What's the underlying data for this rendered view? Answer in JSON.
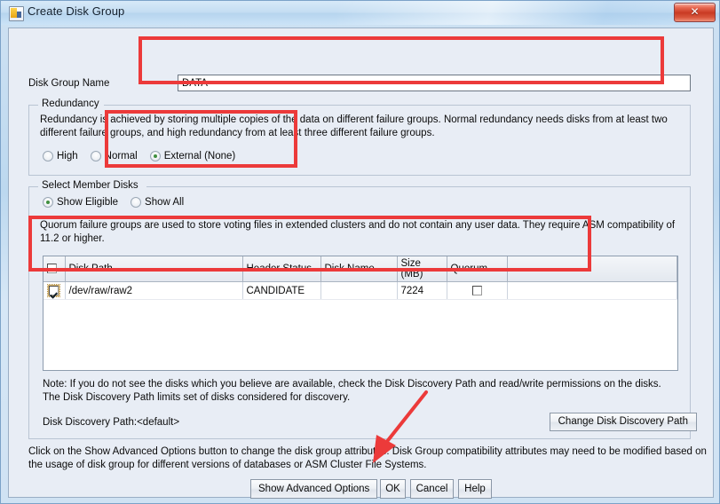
{
  "window": {
    "title": "Create Disk Group",
    "icon": "disk-group-icon",
    "close_label": "✕",
    "close_color": "#c93a23"
  },
  "form": {
    "disk_group_name_label": "Disk Group Name",
    "disk_group_name_value": "DATA"
  },
  "redundancy": {
    "legend": "Redundancy",
    "description": "Redundancy is achieved by storing multiple copies of the data on different failure groups. Normal redundancy needs disks from at least two different failure groups, and high redundancy from at least three different failure groups.",
    "options": [
      {
        "label": "High",
        "selected": false
      },
      {
        "label": "Normal",
        "selected": false
      },
      {
        "label": "External (None)",
        "selected": true
      }
    ]
  },
  "members": {
    "legend": "Select Member Disks",
    "filters": [
      {
        "label": "Show Eligible",
        "selected": true
      },
      {
        "label": "Show All",
        "selected": false
      }
    ],
    "quorum_note": "Quorum failure groups are used to store voting files in extended clusters and do not contain any user data. They require ASM compatibility of 11.2 or higher.",
    "table": {
      "header_checkbox_checked": false,
      "columns": [
        "",
        "Disk Path",
        "Header Status",
        "Disk Name",
        "Size (MB)",
        "Quorum"
      ],
      "rows": [
        {
          "selected": true,
          "disk_path": "/dev/raw/raw2",
          "header_status": "CANDIDATE",
          "disk_name": "",
          "size_mb": "7224",
          "quorum": false
        }
      ]
    },
    "note": "Note: If you do not see the disks which you believe are available, check the Disk Discovery Path and read/write permissions on the disks. The Disk Discovery Path limits set of disks considered for discovery.",
    "discovery_path_label": "Disk Discovery Path:<default>",
    "change_path_button": "Change Disk Discovery Path"
  },
  "footer": {
    "hint": "Click on the Show Advanced Options button to change the disk group attributes. Disk Group compatibility attributes may need to be modified based on the usage of disk group for different versions of databases or ASM Cluster File Systems.",
    "buttons": [
      {
        "label": "Show Advanced Options",
        "name": "show-advanced-options-button"
      },
      {
        "label": "OK",
        "name": "ok-button"
      },
      {
        "label": "Cancel",
        "name": "cancel-button"
      },
      {
        "label": "Help",
        "name": "help-button"
      }
    ]
  },
  "annotations": {
    "highlight_color": "#ec3a3a",
    "boxes": [
      "disk-group-name-field",
      "external-redundancy-option",
      "member-disk-table"
    ],
    "arrow_points_to": "ok-button"
  }
}
